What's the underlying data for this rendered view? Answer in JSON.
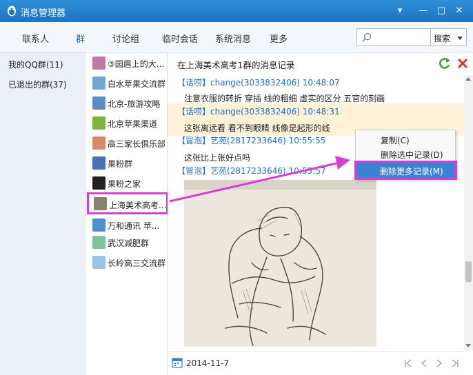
{
  "window": {
    "title": "消息管理器",
    "controls": [
      "▾",
      "—",
      "□",
      "✕"
    ]
  },
  "tabs": [
    {
      "label": "联系人",
      "active": false
    },
    {
      "label": "群",
      "active": true
    },
    {
      "label": "讨论组",
      "active": false
    },
    {
      "label": "临时会话",
      "active": false
    },
    {
      "label": "系统消息",
      "active": false
    },
    {
      "label": "更多",
      "active": false
    }
  ],
  "search": {
    "value": "",
    "placeholder": "",
    "button_label": "搜索"
  },
  "folders": [
    {
      "label": "我的QQ群(11)"
    },
    {
      "label": "已退出的群(37)"
    }
  ],
  "groups": [
    {
      "name": "③园眉上的大...",
      "avatar_color": "#c27aa4",
      "icon": "group-avatar-icon"
    },
    {
      "name": "白水苹果交流群",
      "avatar_color": "#6fa8d8",
      "icon": "group-avatar-icon"
    },
    {
      "name": "北京-旅游攻略",
      "avatar_color": "#5a8fbf",
      "icon": "group-avatar-icon"
    },
    {
      "name": "北京苹果渠道",
      "avatar_color": "#7cb43c",
      "icon": "apple-avatar-icon"
    },
    {
      "name": "高三家长俱乐部",
      "avatar_color": "#d98a6a",
      "icon": "group-avatar-icon"
    },
    {
      "name": "果粉群",
      "avatar_color": "#4a6fb5",
      "icon": "group-avatar-icon"
    },
    {
      "name": "果粉之家",
      "avatar_color": "#222222",
      "icon": "apple-logo-icon"
    },
    {
      "name": "上海美术高考...",
      "avatar_color": "#8b8070",
      "icon": "group-avatar-icon",
      "selected": true
    },
    {
      "name": "万和通讯 苹...",
      "avatar_color": "#4d8fd0",
      "icon": "group-avatar-icon"
    },
    {
      "name": "武汉减肥群",
      "avatar_color": "#7fc2a0",
      "icon": "group-avatar-icon"
    },
    {
      "name": "长岭高三交流群",
      "avatar_color": "#9cc3e6",
      "icon": "group-avatar-icon"
    }
  ],
  "pane": {
    "title": "在上海美术高考1群的消息记录",
    "footer_date": "2014-11-7"
  },
  "messages": [
    {
      "tag": "【话唠】",
      "sender": "change(3033832406)",
      "time": "10:48:07",
      "text": "注意衣服的转折 穿插 线的粗细 虚实的区分 五官的刻画"
    },
    {
      "tag": "【话唠】",
      "sender": "change(3033832406)",
      "time": "10:48:31",
      "text": "这张离远看 看不到眼睛  线像是起形的线",
      "highlighted": true
    },
    {
      "tag": "【冒泡】",
      "sender": "艺苑(2817233646)",
      "time": "10:55:55",
      "text": "这张比上张好点吗"
    },
    {
      "tag": "【冒泡】",
      "sender": "艺苑(2817233646)",
      "time": "10:55:57",
      "text": ""
    }
  ],
  "context_menu": {
    "items": [
      {
        "label": "复制(C)"
      },
      {
        "label": "删除选中记录(D)"
      },
      {
        "label": "删除更多记录(M)",
        "selected": true
      }
    ]
  },
  "colors": {
    "titlebar": "#1c74c2",
    "accent": "#1f6fc0",
    "highlight_row": "#fdf1d7",
    "annotation": "#d63cd6",
    "menu_selected": "#3b83d1"
  }
}
